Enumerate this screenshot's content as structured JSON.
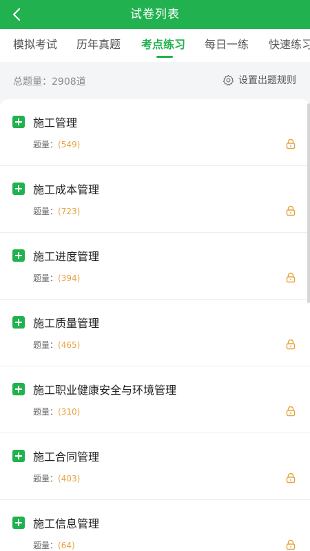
{
  "header": {
    "title": "试卷列表",
    "back_icon": "chevron-left-icon"
  },
  "tabs": [
    {
      "label": "模拟考试",
      "active": false
    },
    {
      "label": "历年真题",
      "active": false
    },
    {
      "label": "考点练习",
      "active": true
    },
    {
      "label": "每日一练",
      "active": false
    },
    {
      "label": "快速练习",
      "active": false
    }
  ],
  "summary": {
    "total_label": "总题量：2908道",
    "settings_label": "设置出题规则",
    "settings_icon": "gear-icon"
  },
  "count_prefix": "题量：",
  "items": [
    {
      "title": "施工管理",
      "count": "(549)"
    },
    {
      "title": "施工成本管理",
      "count": "(723)"
    },
    {
      "title": "施工进度管理",
      "count": "(394)"
    },
    {
      "title": "施工质量管理",
      "count": "(465)"
    },
    {
      "title": "施工职业健康安全与环境管理",
      "count": "(310)"
    },
    {
      "title": "施工合同管理",
      "count": "(403)"
    },
    {
      "title": "施工信息管理",
      "count": "(64)"
    }
  ],
  "colors": {
    "brand": "#21b14f",
    "count_accent": "#e8a23d",
    "background": "#f4f5f7"
  }
}
